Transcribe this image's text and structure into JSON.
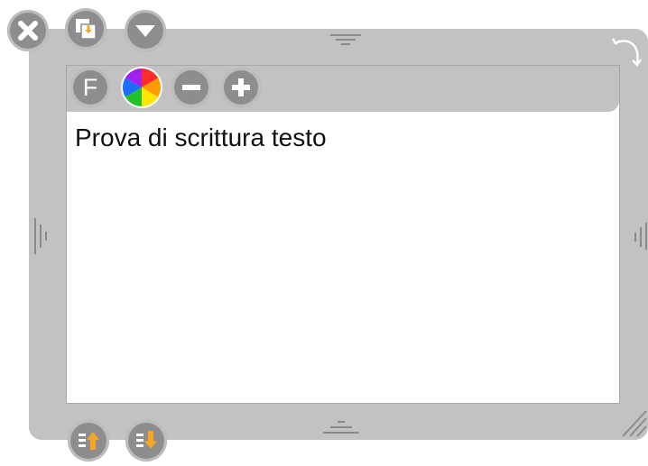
{
  "editor": {
    "text": "Prova di scrittura testo"
  },
  "toolbar": {
    "font_label": "F"
  },
  "icons": {
    "close": "close-icon",
    "duplicate": "duplicate-icon",
    "collapse": "chevron-down-icon",
    "font": "font-icon",
    "color": "color-wheel-icon",
    "decrease": "minus-icon",
    "increase": "plus-icon",
    "bring_forward": "bring-forward-icon",
    "send_backward": "send-backward-icon",
    "rotate": "rotate-icon",
    "resize": "resize-handle-icon"
  },
  "colors": {
    "frame": "#c2c2c2",
    "button": "#8d8d8d",
    "accent": "#f5a623",
    "text": "#111111"
  }
}
